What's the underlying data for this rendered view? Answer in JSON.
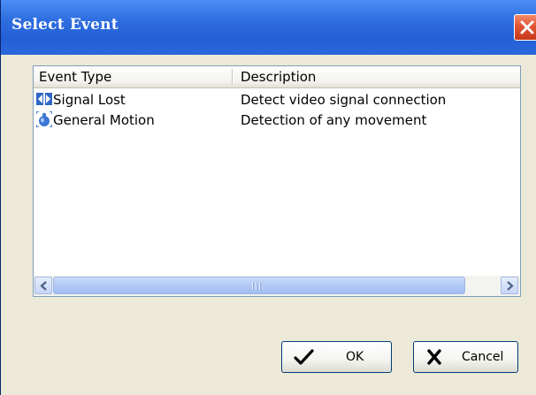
{
  "dialog": {
    "title": "Select Event",
    "close_icon": "close-icon",
    "accent_color": "#2f6fe0"
  },
  "list": {
    "columns": [
      "Event Type",
      "Description"
    ],
    "rows": [
      {
        "event_type": "Signal Lost",
        "description": "Detect video signal connection",
        "icon": "signal-lost-icon"
      },
      {
        "event_type": "General Motion",
        "description": "Detection of any movement",
        "icon": "general-motion-icon"
      }
    ],
    "scroll_grip": "III"
  },
  "buttons": {
    "ok_label": "OK",
    "ok_icon": "checkmark-icon",
    "cancel_label": "Cancel",
    "cancel_icon": "x-mark-icon"
  }
}
